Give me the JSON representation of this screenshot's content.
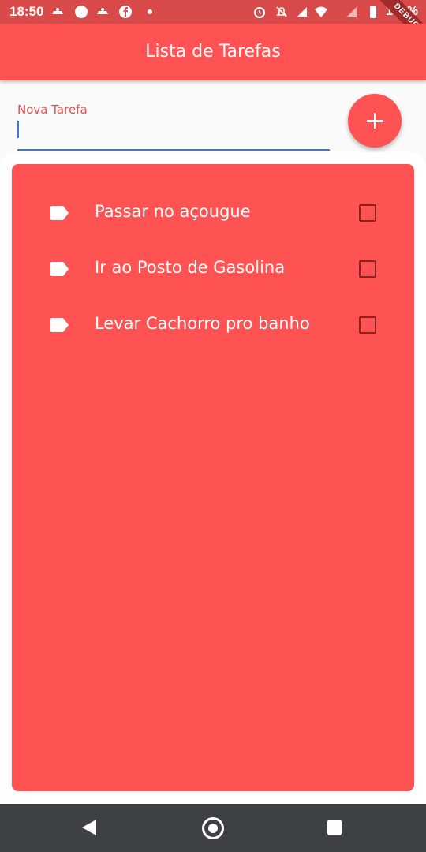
{
  "status_bar": {
    "time": "18:50",
    "battery_text": "100%",
    "icons": [
      "notification-icon",
      "circle-icon",
      "notification-icon",
      "facebook-icon",
      "dot-icon",
      "alarm-icon",
      "mute-icon",
      "signal-4g-icon",
      "wifi-icon",
      "signal-icon",
      "battery-icon"
    ]
  },
  "debug_banner": {
    "label": "DEBUG"
  },
  "app_bar": {
    "title": "Lista de Tarefas",
    "color": "#ff5252"
  },
  "input": {
    "label": "Nova Tarefa",
    "value": "",
    "underline_color": "#3a7bd5"
  },
  "fab": {
    "icon": "plus-icon"
  },
  "tasks": [
    {
      "label": "Passar no açougue",
      "checked": false,
      "icon": "label-icon"
    },
    {
      "label": "Ir ao Posto de Gasolina",
      "checked": false,
      "icon": "label-icon"
    },
    {
      "label": "Levar Cachorro pro banho",
      "checked": false,
      "icon": "label-icon"
    }
  ],
  "nav_bar": {
    "icons": [
      "back-icon",
      "home-icon",
      "recents-icon"
    ]
  }
}
